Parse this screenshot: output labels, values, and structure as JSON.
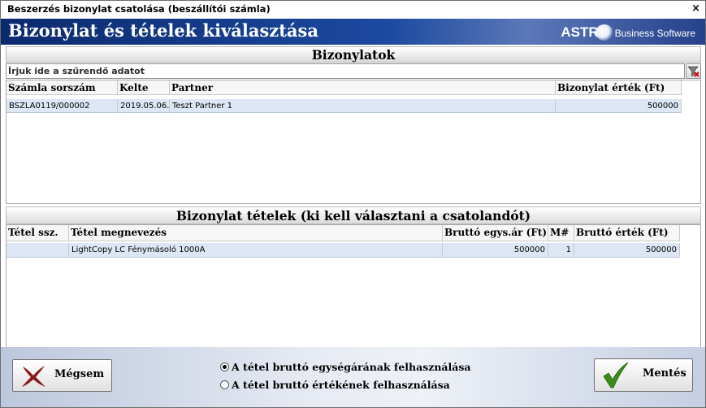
{
  "window": {
    "title": "Beszerzés bizonylat csatolása (beszállítói számla)",
    "close_glyph": "×"
  },
  "banner": {
    "title": "Bizonylat és tételek kiválasztása",
    "logo_text": "ASTR",
    "logo_subtitle": "Business Software"
  },
  "documents": {
    "section_title": "Bizonylatok",
    "filter_placeholder": "Írjuk ide a szűrendő adatot",
    "filter_value": "",
    "columns": [
      "Számla sorszám",
      "Kelte",
      "Partner",
      "Bizonylat érték (Ft)"
    ],
    "rows": [
      {
        "number": "BSZLA0119/000002",
        "date": "2019.05.06.",
        "partner": "Teszt Partner 1",
        "value": "500000"
      }
    ]
  },
  "items": {
    "section_title": "Bizonylat tételek (ki kell választani a csatolandót)",
    "columns": [
      "Tétel ssz.",
      "Tétel megnevezés",
      "Bruttó egys.ár (Ft)",
      "M#",
      "Bruttó érték (Ft)"
    ],
    "rows": [
      {
        "seq": "",
        "name": "LightCopy LC Fénymásoló 1000A",
        "unit_price": "500000",
        "qty": "1",
        "value": "500000"
      }
    ]
  },
  "footer": {
    "cancel_label": "Mégsem",
    "save_label": "Mentés",
    "options": [
      {
        "label": "A tétel bruttó egységárának felhasználása",
        "selected": true
      },
      {
        "label": "A tétel bruttó értékének felhasználása",
        "selected": false
      }
    ]
  },
  "colors": {
    "banner_dark": "#0b2a6e",
    "selected_row": "#dde6f4",
    "cancel_icon": "#8b1a1a",
    "save_icon": "#3a8a1a"
  }
}
